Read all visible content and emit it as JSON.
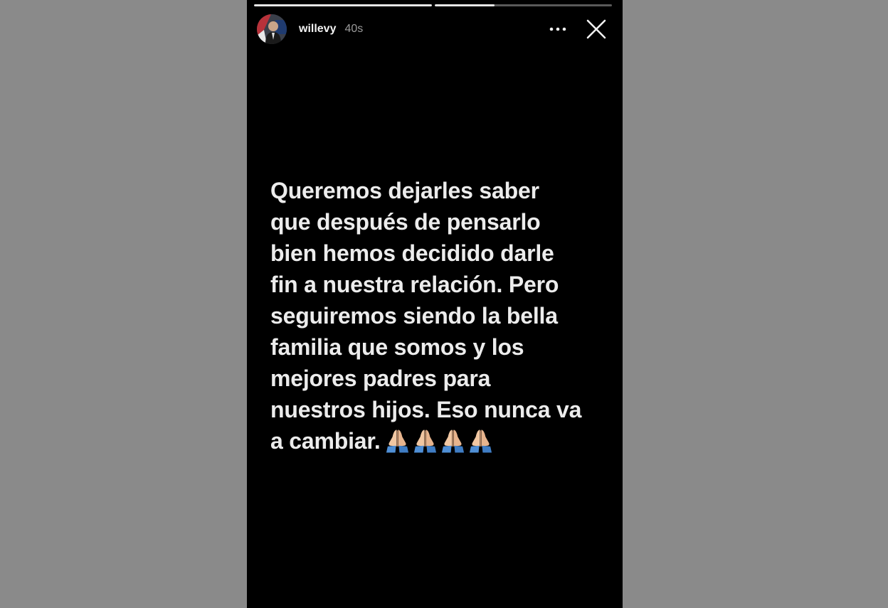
{
  "story": {
    "progress": [
      1.0,
      0.34
    ],
    "user": {
      "username": "willevy",
      "time": "40s"
    },
    "message_text": "Queremos dejarles saber\nque después de pensarlo\nbien hemos decidido darle\nfin a nuestra relación. Pero\nseguiremos siendo la bella\nfamilia que somos y los\nmejores padres para\nnuestros hijos. Eso nunca va\na cambiar.",
    "emojis": [
      "folded-hands-icon",
      "folded-hands-icon",
      "folded-hands-icon",
      "folded-hands-icon"
    ]
  },
  "colors": {
    "background": "#8a8a8a",
    "story_background": "#000000",
    "text": "#ececec"
  }
}
